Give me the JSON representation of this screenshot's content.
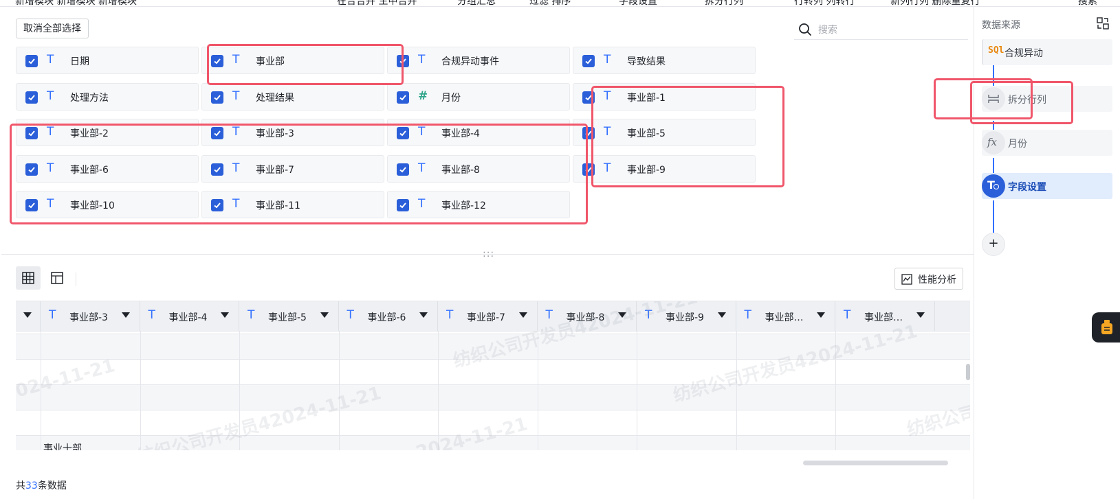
{
  "top_strip": [
    "新增模块 新增模块 新增模块",
    "在合合并 主中合并",
    "分组汇总",
    "过滤 排序",
    "字段设置",
    "拆分行列",
    "行转列 列转行",
    "新列行列 删除重复行",
    "搜索"
  ],
  "field_panel": {
    "deselect_all_label": "取消全部选择",
    "search_placeholder": "搜索",
    "fields": [
      {
        "name": "日期",
        "type": "T"
      },
      {
        "name": "事业部",
        "type": "T"
      },
      {
        "name": "合规异动事件",
        "type": "T"
      },
      {
        "name": "导致结果",
        "type": "T"
      },
      {
        "name": "处理方法",
        "type": "T"
      },
      {
        "name": "处理结果",
        "type": "T"
      },
      {
        "name": "月份",
        "type": "#"
      },
      {
        "name": "事业部-1",
        "type": "T"
      },
      {
        "name": "事业部-2",
        "type": "T"
      },
      {
        "name": "事业部-3",
        "type": "T"
      },
      {
        "name": "事业部-4",
        "type": "T"
      },
      {
        "name": "事业部-5",
        "type": "T"
      },
      {
        "name": "事业部-6",
        "type": "T"
      },
      {
        "name": "事业部-7",
        "type": "T"
      },
      {
        "name": "事业部-8",
        "type": "T"
      },
      {
        "name": "事业部-9",
        "type": "T"
      },
      {
        "name": "事业部-10",
        "type": "T"
      },
      {
        "name": "事业部-11",
        "type": "T"
      },
      {
        "name": "事业部-12",
        "type": "T"
      }
    ]
  },
  "splitter_dots": ":::",
  "preview": {
    "perf_label": "性能分析",
    "columns": [
      "事业部-3",
      "事业部-4",
      "事业部-5",
      "事业部-6",
      "事业部-7",
      "事业部-8",
      "事业部-9",
      "事业部…",
      "事业部…"
    ],
    "visible_cell": "事业十部",
    "watermark_text": "纺织公司开发员42024-11-21",
    "watermark_date": "2024-11-21"
  },
  "footer": {
    "prefix": "共",
    "count": "33",
    "suffix": "条数据"
  },
  "sidebar": {
    "title": "数据来源",
    "steps": [
      {
        "label": "合规异动",
        "icon": "sql-icon"
      },
      {
        "label": "拆分行列",
        "icon": "split-icon"
      },
      {
        "label": "月份",
        "icon": "fx-icon"
      },
      {
        "label": "字段设置",
        "icon": "field-settings-icon"
      }
    ],
    "add_label": "+"
  },
  "colors": {
    "accent": "#3370ff",
    "checkbox": "#2b5fd9",
    "highlight": "#f0566a",
    "active_step_bg": "#e1ecfd"
  }
}
